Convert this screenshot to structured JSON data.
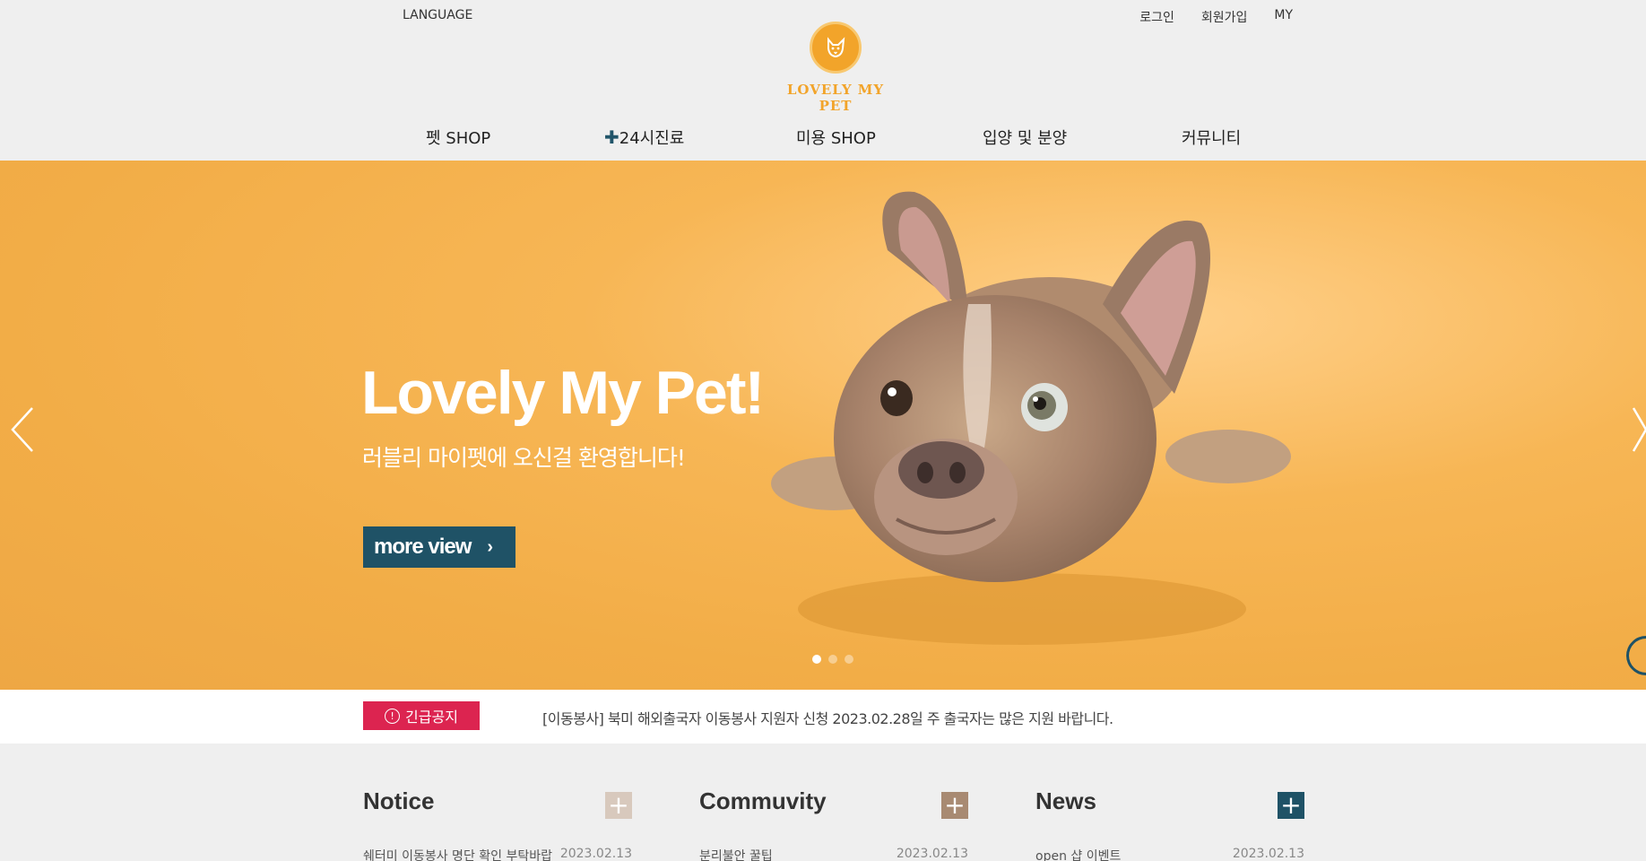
{
  "header": {
    "language": "LANGUAGE",
    "utils": [
      "로그인",
      "회원가입",
      "MY"
    ],
    "logo_text": "LOVELY MY PET"
  },
  "gnb": [
    {
      "label": "펫 SHOP"
    },
    {
      "label": "24시진료"
    },
    {
      "label": "미용 SHOP"
    },
    {
      "label": "입양 및 분양"
    },
    {
      "label": "커뮤니티"
    }
  ],
  "hero": {
    "title": "Lovely My Pet!",
    "subtitle": "러블리 마이펫에 오신걸 환영합니다!",
    "button": "more view",
    "slide_count": 3,
    "active_slide": 1
  },
  "notice": {
    "badge": "긴급공지",
    "text": "[이동봉사] 북미 해외출국자 이동봉사 지원자 신청 2023.02.28일 주 출국자는 많은 지원 바랍니다."
  },
  "boards": [
    {
      "title": "Notice",
      "more_color": "#d8c9bd",
      "item": "쉐터미 이동봉사 명단 확인 부탁바랍",
      "date": "2023.02.13"
    },
    {
      "title": "Commuvity",
      "more_color": "#a88a72",
      "item": "분리불안 꿀팁",
      "date": "2023.02.13"
    },
    {
      "title": "News",
      "more_color": "#1f5266",
      "item": "open 샵 이벤트",
      "date": "2023.02.13"
    }
  ]
}
